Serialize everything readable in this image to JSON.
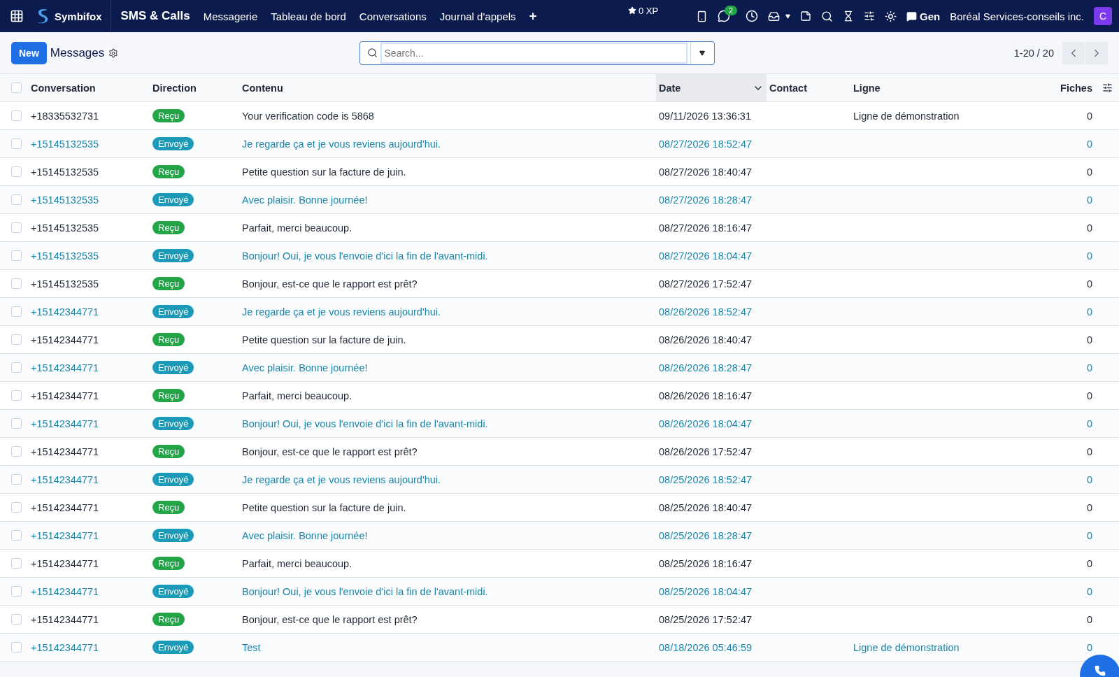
{
  "nav": {
    "brand": "Symbifox",
    "app": "SMS & Calls",
    "menu": [
      "Messagerie",
      "Tableau de bord",
      "Conversations",
      "Journal d'appels"
    ],
    "add": "+",
    "xp": "0 XP",
    "chat_badge": "2",
    "gen": "Gen",
    "company": "Boréal Services-conseils inc.",
    "avatar": "C"
  },
  "toolbar": {
    "new": "New",
    "title": "Messages",
    "search": {
      "placeholder": "Search..."
    },
    "pager": "1-20 / 20"
  },
  "table": {
    "all_checked": false,
    "columns": [
      {
        "label": "Conversation",
        "sorted": false
      },
      {
        "label": "Direction",
        "sorted": false
      },
      {
        "label": "Contenu",
        "sorted": false
      },
      {
        "label": "Date",
        "sorted": true
      },
      {
        "label": "Contact",
        "sorted": false
      },
      {
        "label": "Ligne",
        "sorted": false
      },
      {
        "label": "Fiches",
        "sorted": false
      }
    ],
    "rows": [
      {
        "checked": false,
        "conversation": "+18335532731",
        "direction": {
          "label": "Reçu",
          "kind": "received"
        },
        "content": "Your verification code is 5868",
        "date": "09/11/2026 13:36:31",
        "ligne": "Ligne de démonstration",
        "fiches": "0"
      },
      {
        "checked": false,
        "conversation": "+15145132535",
        "direction": {
          "label": "Envoyé",
          "kind": "sent"
        },
        "content": "Je regarde ça et je vous reviens aujourd'hui.",
        "date": "08/27/2026 18:52:47",
        "fiches": "0"
      },
      {
        "checked": false,
        "conversation": "+15145132535",
        "direction": {
          "label": "Reçu",
          "kind": "received"
        },
        "content": "Petite question sur la facture de juin.",
        "date": "08/27/2026 18:40:47",
        "fiches": "0"
      },
      {
        "checked": false,
        "conversation": "+15145132535",
        "direction": {
          "label": "Envoyé",
          "kind": "sent"
        },
        "content": "Avec plaisir. Bonne journée!",
        "date": "08/27/2026 18:28:47",
        "fiches": "0"
      },
      {
        "checked": false,
        "conversation": "+15145132535",
        "direction": {
          "label": "Reçu",
          "kind": "received"
        },
        "content": "Parfait, merci beaucoup.",
        "date": "08/27/2026 18:16:47",
        "fiches": "0"
      },
      {
        "checked": false,
        "conversation": "+15145132535",
        "direction": {
          "label": "Envoyé",
          "kind": "sent"
        },
        "content": "Bonjour! Oui, je vous l'envoie d'ici la fin de l'avant-midi.",
        "date": "08/27/2026 18:04:47",
        "fiches": "0"
      },
      {
        "checked": false,
        "conversation": "+15145132535",
        "direction": {
          "label": "Reçu",
          "kind": "received"
        },
        "content": "Bonjour, est-ce que le rapport est prêt?",
        "date": "08/27/2026 17:52:47",
        "fiches": "0"
      },
      {
        "checked": false,
        "conversation": "+15142344771",
        "direction": {
          "label": "Envoyé",
          "kind": "sent"
        },
        "content": "Je regarde ça et je vous reviens aujourd'hui.",
        "date": "08/26/2026 18:52:47",
        "fiches": "0"
      },
      {
        "checked": false,
        "conversation": "+15142344771",
        "direction": {
          "label": "Reçu",
          "kind": "received"
        },
        "content": "Petite question sur la facture de juin.",
        "date": "08/26/2026 18:40:47",
        "fiches": "0"
      },
      {
        "checked": false,
        "conversation": "+15142344771",
        "direction": {
          "label": "Envoyé",
          "kind": "sent"
        },
        "content": "Avec plaisir. Bonne journée!",
        "date": "08/26/2026 18:28:47",
        "fiches": "0"
      },
      {
        "checked": false,
        "conversation": "+15142344771",
        "direction": {
          "label": "Reçu",
          "kind": "received"
        },
        "content": "Parfait, merci beaucoup.",
        "date": "08/26/2026 18:16:47",
        "fiches": "0"
      },
      {
        "checked": false,
        "conversation": "+15142344771",
        "direction": {
          "label": "Envoyé",
          "kind": "sent"
        },
        "content": "Bonjour! Oui, je vous l'envoie d'ici la fin de l'avant-midi.",
        "date": "08/26/2026 18:04:47",
        "fiches": "0"
      },
      {
        "checked": false,
        "conversation": "+15142344771",
        "direction": {
          "label": "Reçu",
          "kind": "received"
        },
        "content": "Bonjour, est-ce que le rapport est prêt?",
        "date": "08/26/2026 17:52:47",
        "fiches": "0"
      },
      {
        "checked": false,
        "conversation": "+15142344771",
        "direction": {
          "label": "Envoyé",
          "kind": "sent"
        },
        "content": "Je regarde ça et je vous reviens aujourd'hui.",
        "date": "08/25/2026 18:52:47",
        "fiches": "0"
      },
      {
        "checked": false,
        "conversation": "+15142344771",
        "direction": {
          "label": "Reçu",
          "kind": "received"
        },
        "content": "Petite question sur la facture de juin.",
        "date": "08/25/2026 18:40:47",
        "fiches": "0"
      },
      {
        "checked": false,
        "conversation": "+15142344771",
        "direction": {
          "label": "Envoyé",
          "kind": "sent"
        },
        "content": "Avec plaisir. Bonne journée!",
        "date": "08/25/2026 18:28:47",
        "fiches": "0"
      },
      {
        "checked": false,
        "conversation": "+15142344771",
        "direction": {
          "label": "Reçu",
          "kind": "received"
        },
        "content": "Parfait, merci beaucoup.",
        "date": "08/25/2026 18:16:47",
        "fiches": "0"
      },
      {
        "checked": false,
        "conversation": "+15142344771",
        "direction": {
          "label": "Envoyé",
          "kind": "sent"
        },
        "content": "Bonjour! Oui, je vous l'envoie d'ici la fin de l'avant-midi.",
        "date": "08/25/2026 18:04:47",
        "fiches": "0"
      },
      {
        "checked": false,
        "conversation": "+15142344771",
        "direction": {
          "label": "Reçu",
          "kind": "received"
        },
        "content": "Bonjour, est-ce que le rapport est prêt?",
        "date": "08/25/2026 17:52:47",
        "fiches": "0"
      },
      {
        "checked": false,
        "conversation": "+15142344771",
        "direction": {
          "label": "Envoyé",
          "kind": "sent"
        },
        "content": "Test",
        "date": "08/18/2026 05:46:59",
        "ligne": "Ligne de démonstration",
        "fiches": "0"
      }
    ]
  }
}
